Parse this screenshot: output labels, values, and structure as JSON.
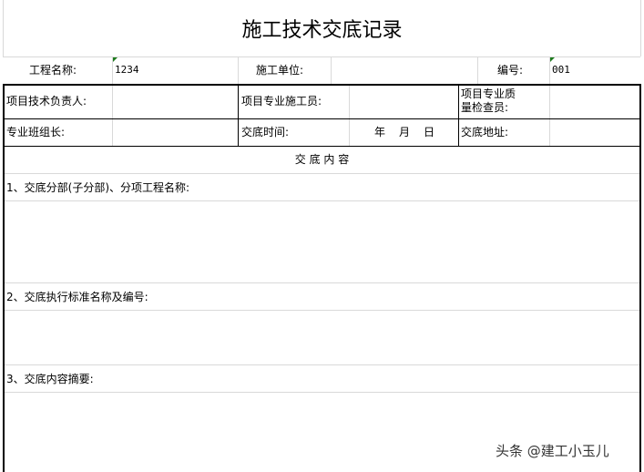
{
  "title": "施工技术交底记录",
  "row1": {
    "project_name_label": "工程名称:",
    "project_name_value": "1234",
    "unit_label": "施工单位:",
    "unit_value": "",
    "number_label": "编号:",
    "number_value": "001"
  },
  "row2": {
    "tech_lead_label": "项目技术负责人:",
    "constructor_label": "项目专业施工员:",
    "qc_label_line1": "项目专业质",
    "qc_label_line2": "量检查员:"
  },
  "row3": {
    "team_lead_label": "专业班组长:",
    "time_label": "交底时间:",
    "year": "年",
    "month": "月",
    "day": "日",
    "address_label": "交底地址:"
  },
  "section_header": "交 底 内 容",
  "sections": [
    "1、交底分部(子分部)、分项工程名称:",
    "2、交底执行标准名称及编号:",
    "3、交底内容摘要:"
  ],
  "watermark": "头条 @建工小玉儿"
}
